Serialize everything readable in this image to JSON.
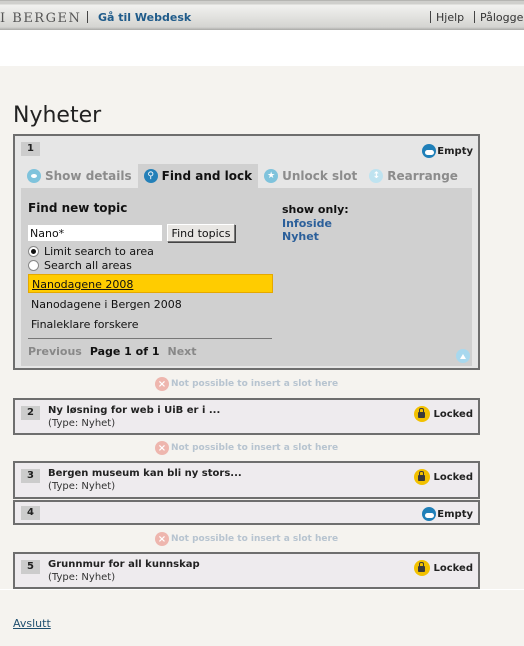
{
  "header": {
    "brand": "I BERGEN",
    "webdesk_link": "Gå til Webdesk",
    "help_link": "Hjelp",
    "login_link": "Pålogge"
  },
  "page_title": "Nyheter",
  "slots": [
    {
      "number": "1",
      "status": "Empty",
      "status_icon": "cloud-icon",
      "tabs": [
        {
          "label": "Show details",
          "icon": "eye-icon",
          "active": false
        },
        {
          "label": "Find and lock",
          "icon": "magnifier-icon",
          "active": true
        },
        {
          "label": "Unlock slot",
          "icon": "star-icon",
          "active": false
        },
        {
          "label": "Rearrange",
          "icon": "arrows-icon",
          "active": false
        }
      ],
      "find": {
        "heading": "Find new topic",
        "search_value": "Nano*",
        "button_label": "Find topics",
        "radio_limit": "Limit search to area",
        "radio_all": "Search all areas",
        "radio_selected": "limit",
        "results": [
          "Nanodagene 2008",
          "Nanodagene i Bergen 2008",
          "Finaleklare forskere"
        ],
        "selected_result": "Nanodagene 2008",
        "pager": {
          "previous": "Previous",
          "current": "Page 1 of 1",
          "next": "Next"
        },
        "show_only_label": "show only:",
        "filters": [
          "Infoside",
          "Nyhet"
        ]
      }
    },
    {
      "number": "2",
      "title": "Ny løsning for web i UiB er i ...",
      "type": "(Type: Nyhet)",
      "status": "Locked"
    },
    {
      "number": "3",
      "title": "Bergen museum kan bli ny stors...",
      "type": "(Type: Nyhet)",
      "status": "Locked"
    },
    {
      "number": "4",
      "status": "Empty"
    },
    {
      "number": "5",
      "title": "Grunnmur for all kunnskap",
      "type": "(Type: Nyhet)",
      "status": "Locked"
    }
  ],
  "insert_note": "Not possible to insert a slot here",
  "footer": {
    "exit_link": "Avslutt"
  }
}
